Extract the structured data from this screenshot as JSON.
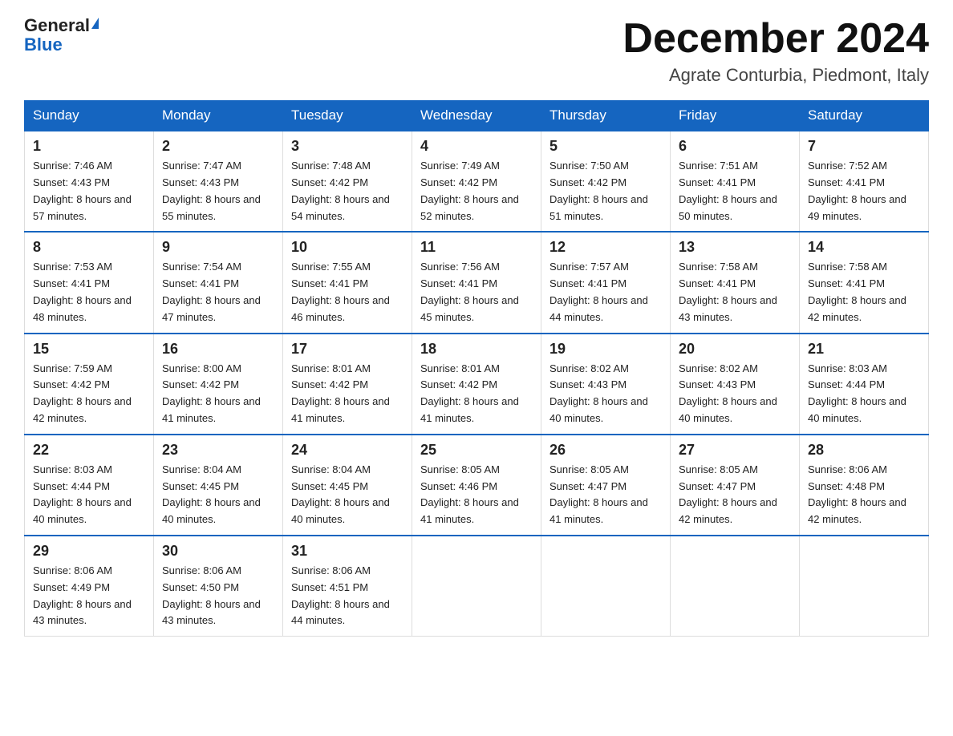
{
  "header": {
    "logo_general": "General",
    "logo_blue": "Blue",
    "month_title": "December 2024",
    "location": "Agrate Conturbia, Piedmont, Italy"
  },
  "days_of_week": [
    "Sunday",
    "Monday",
    "Tuesday",
    "Wednesday",
    "Thursday",
    "Friday",
    "Saturday"
  ],
  "weeks": [
    [
      {
        "day": "1",
        "sunrise": "7:46 AM",
        "sunset": "4:43 PM",
        "daylight": "8 hours and 57 minutes."
      },
      {
        "day": "2",
        "sunrise": "7:47 AM",
        "sunset": "4:43 PM",
        "daylight": "8 hours and 55 minutes."
      },
      {
        "day": "3",
        "sunrise": "7:48 AM",
        "sunset": "4:42 PM",
        "daylight": "8 hours and 54 minutes."
      },
      {
        "day": "4",
        "sunrise": "7:49 AM",
        "sunset": "4:42 PM",
        "daylight": "8 hours and 52 minutes."
      },
      {
        "day": "5",
        "sunrise": "7:50 AM",
        "sunset": "4:42 PM",
        "daylight": "8 hours and 51 minutes."
      },
      {
        "day": "6",
        "sunrise": "7:51 AM",
        "sunset": "4:41 PM",
        "daylight": "8 hours and 50 minutes."
      },
      {
        "day": "7",
        "sunrise": "7:52 AM",
        "sunset": "4:41 PM",
        "daylight": "8 hours and 49 minutes."
      }
    ],
    [
      {
        "day": "8",
        "sunrise": "7:53 AM",
        "sunset": "4:41 PM",
        "daylight": "8 hours and 48 minutes."
      },
      {
        "day": "9",
        "sunrise": "7:54 AM",
        "sunset": "4:41 PM",
        "daylight": "8 hours and 47 minutes."
      },
      {
        "day": "10",
        "sunrise": "7:55 AM",
        "sunset": "4:41 PM",
        "daylight": "8 hours and 46 minutes."
      },
      {
        "day": "11",
        "sunrise": "7:56 AM",
        "sunset": "4:41 PM",
        "daylight": "8 hours and 45 minutes."
      },
      {
        "day": "12",
        "sunrise": "7:57 AM",
        "sunset": "4:41 PM",
        "daylight": "8 hours and 44 minutes."
      },
      {
        "day": "13",
        "sunrise": "7:58 AM",
        "sunset": "4:41 PM",
        "daylight": "8 hours and 43 minutes."
      },
      {
        "day": "14",
        "sunrise": "7:58 AM",
        "sunset": "4:41 PM",
        "daylight": "8 hours and 42 minutes."
      }
    ],
    [
      {
        "day": "15",
        "sunrise": "7:59 AM",
        "sunset": "4:42 PM",
        "daylight": "8 hours and 42 minutes."
      },
      {
        "day": "16",
        "sunrise": "8:00 AM",
        "sunset": "4:42 PM",
        "daylight": "8 hours and 41 minutes."
      },
      {
        "day": "17",
        "sunrise": "8:01 AM",
        "sunset": "4:42 PM",
        "daylight": "8 hours and 41 minutes."
      },
      {
        "day": "18",
        "sunrise": "8:01 AM",
        "sunset": "4:42 PM",
        "daylight": "8 hours and 41 minutes."
      },
      {
        "day": "19",
        "sunrise": "8:02 AM",
        "sunset": "4:43 PM",
        "daylight": "8 hours and 40 minutes."
      },
      {
        "day": "20",
        "sunrise": "8:02 AM",
        "sunset": "4:43 PM",
        "daylight": "8 hours and 40 minutes."
      },
      {
        "day": "21",
        "sunrise": "8:03 AM",
        "sunset": "4:44 PM",
        "daylight": "8 hours and 40 minutes."
      }
    ],
    [
      {
        "day": "22",
        "sunrise": "8:03 AM",
        "sunset": "4:44 PM",
        "daylight": "8 hours and 40 minutes."
      },
      {
        "day": "23",
        "sunrise": "8:04 AM",
        "sunset": "4:45 PM",
        "daylight": "8 hours and 40 minutes."
      },
      {
        "day": "24",
        "sunrise": "8:04 AM",
        "sunset": "4:45 PM",
        "daylight": "8 hours and 40 minutes."
      },
      {
        "day": "25",
        "sunrise": "8:05 AM",
        "sunset": "4:46 PM",
        "daylight": "8 hours and 41 minutes."
      },
      {
        "day": "26",
        "sunrise": "8:05 AM",
        "sunset": "4:47 PM",
        "daylight": "8 hours and 41 minutes."
      },
      {
        "day": "27",
        "sunrise": "8:05 AM",
        "sunset": "4:47 PM",
        "daylight": "8 hours and 42 minutes."
      },
      {
        "day": "28",
        "sunrise": "8:06 AM",
        "sunset": "4:48 PM",
        "daylight": "8 hours and 42 minutes."
      }
    ],
    [
      {
        "day": "29",
        "sunrise": "8:06 AM",
        "sunset": "4:49 PM",
        "daylight": "8 hours and 43 minutes."
      },
      {
        "day": "30",
        "sunrise": "8:06 AM",
        "sunset": "4:50 PM",
        "daylight": "8 hours and 43 minutes."
      },
      {
        "day": "31",
        "sunrise": "8:06 AM",
        "sunset": "4:51 PM",
        "daylight": "8 hours and 44 minutes."
      },
      null,
      null,
      null,
      null
    ]
  ]
}
